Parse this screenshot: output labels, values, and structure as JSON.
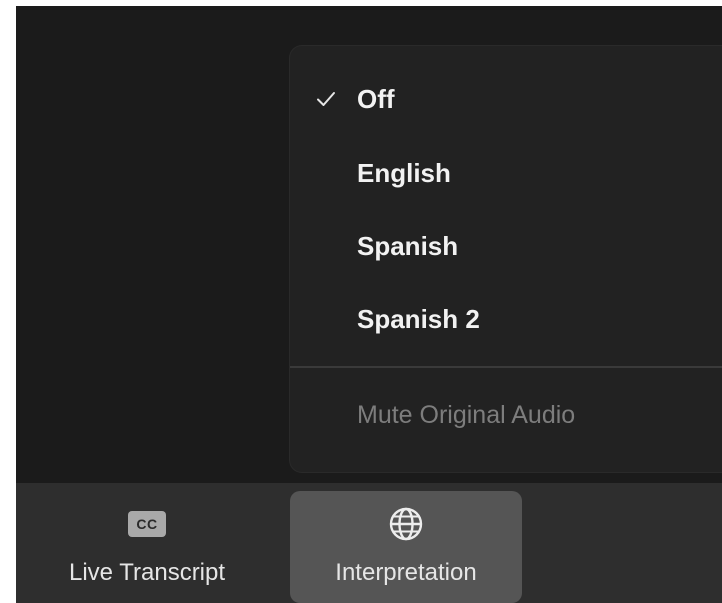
{
  "interpretation_menu": {
    "items": [
      {
        "label": "Off",
        "checked": true
      },
      {
        "label": "English",
        "checked": false
      },
      {
        "label": "Spanish",
        "checked": false
      },
      {
        "label": "Spanish 2",
        "checked": false
      }
    ],
    "mute_original_audio": {
      "label": "Mute Original Audio",
      "enabled": false
    }
  },
  "toolbar": {
    "live_transcript": {
      "icon_text": "CC",
      "label": "Live Transcript"
    },
    "interpretation": {
      "icon": "globe-icon",
      "label": "Interpretation",
      "active": true
    }
  },
  "colors": {
    "background": "#1b1b1b",
    "menu_background": "#222222",
    "toolbar_background": "#2e2e2e",
    "active_button": "#555555",
    "disabled_text": "#7d7d7d"
  }
}
